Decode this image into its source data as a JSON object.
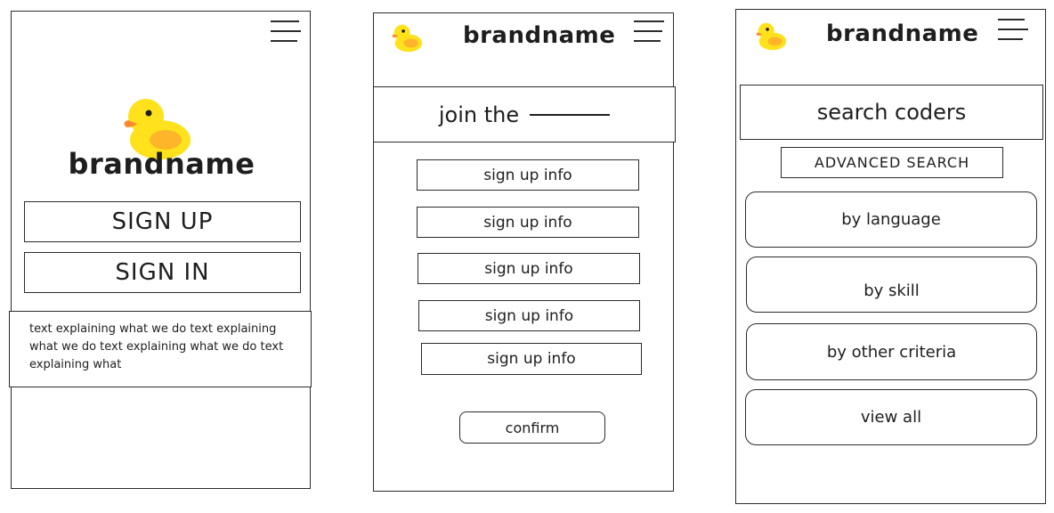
{
  "colors": {
    "stroke": "#2b2b2b",
    "duck_body": "#FFE21C",
    "duck_wing": "#FFB52A",
    "duck_beak": "#FF8A30",
    "background": "#ffffff"
  },
  "screen1": {
    "menu_icon": "hamburger-menu-icon",
    "logo_icon": "duck-logo-icon",
    "brand": "brandname",
    "signup": "SIGN UP",
    "signin": "SIGN IN",
    "description": "text explaining what we do text explaining what we do text explaining what we do text explaining what"
  },
  "screen2": {
    "brand": "brandname",
    "join_title": "join the",
    "fields": [
      "sign up info",
      "sign up info",
      "sign up info",
      "sign up info",
      "sign up info"
    ],
    "confirm": "confirm"
  },
  "screen3": {
    "brand": "brandname",
    "search_title": "search coders",
    "advanced": "ADVANCED SEARCH",
    "options": [
      "by language",
      "by skill",
      "by other criteria",
      "view all"
    ]
  }
}
